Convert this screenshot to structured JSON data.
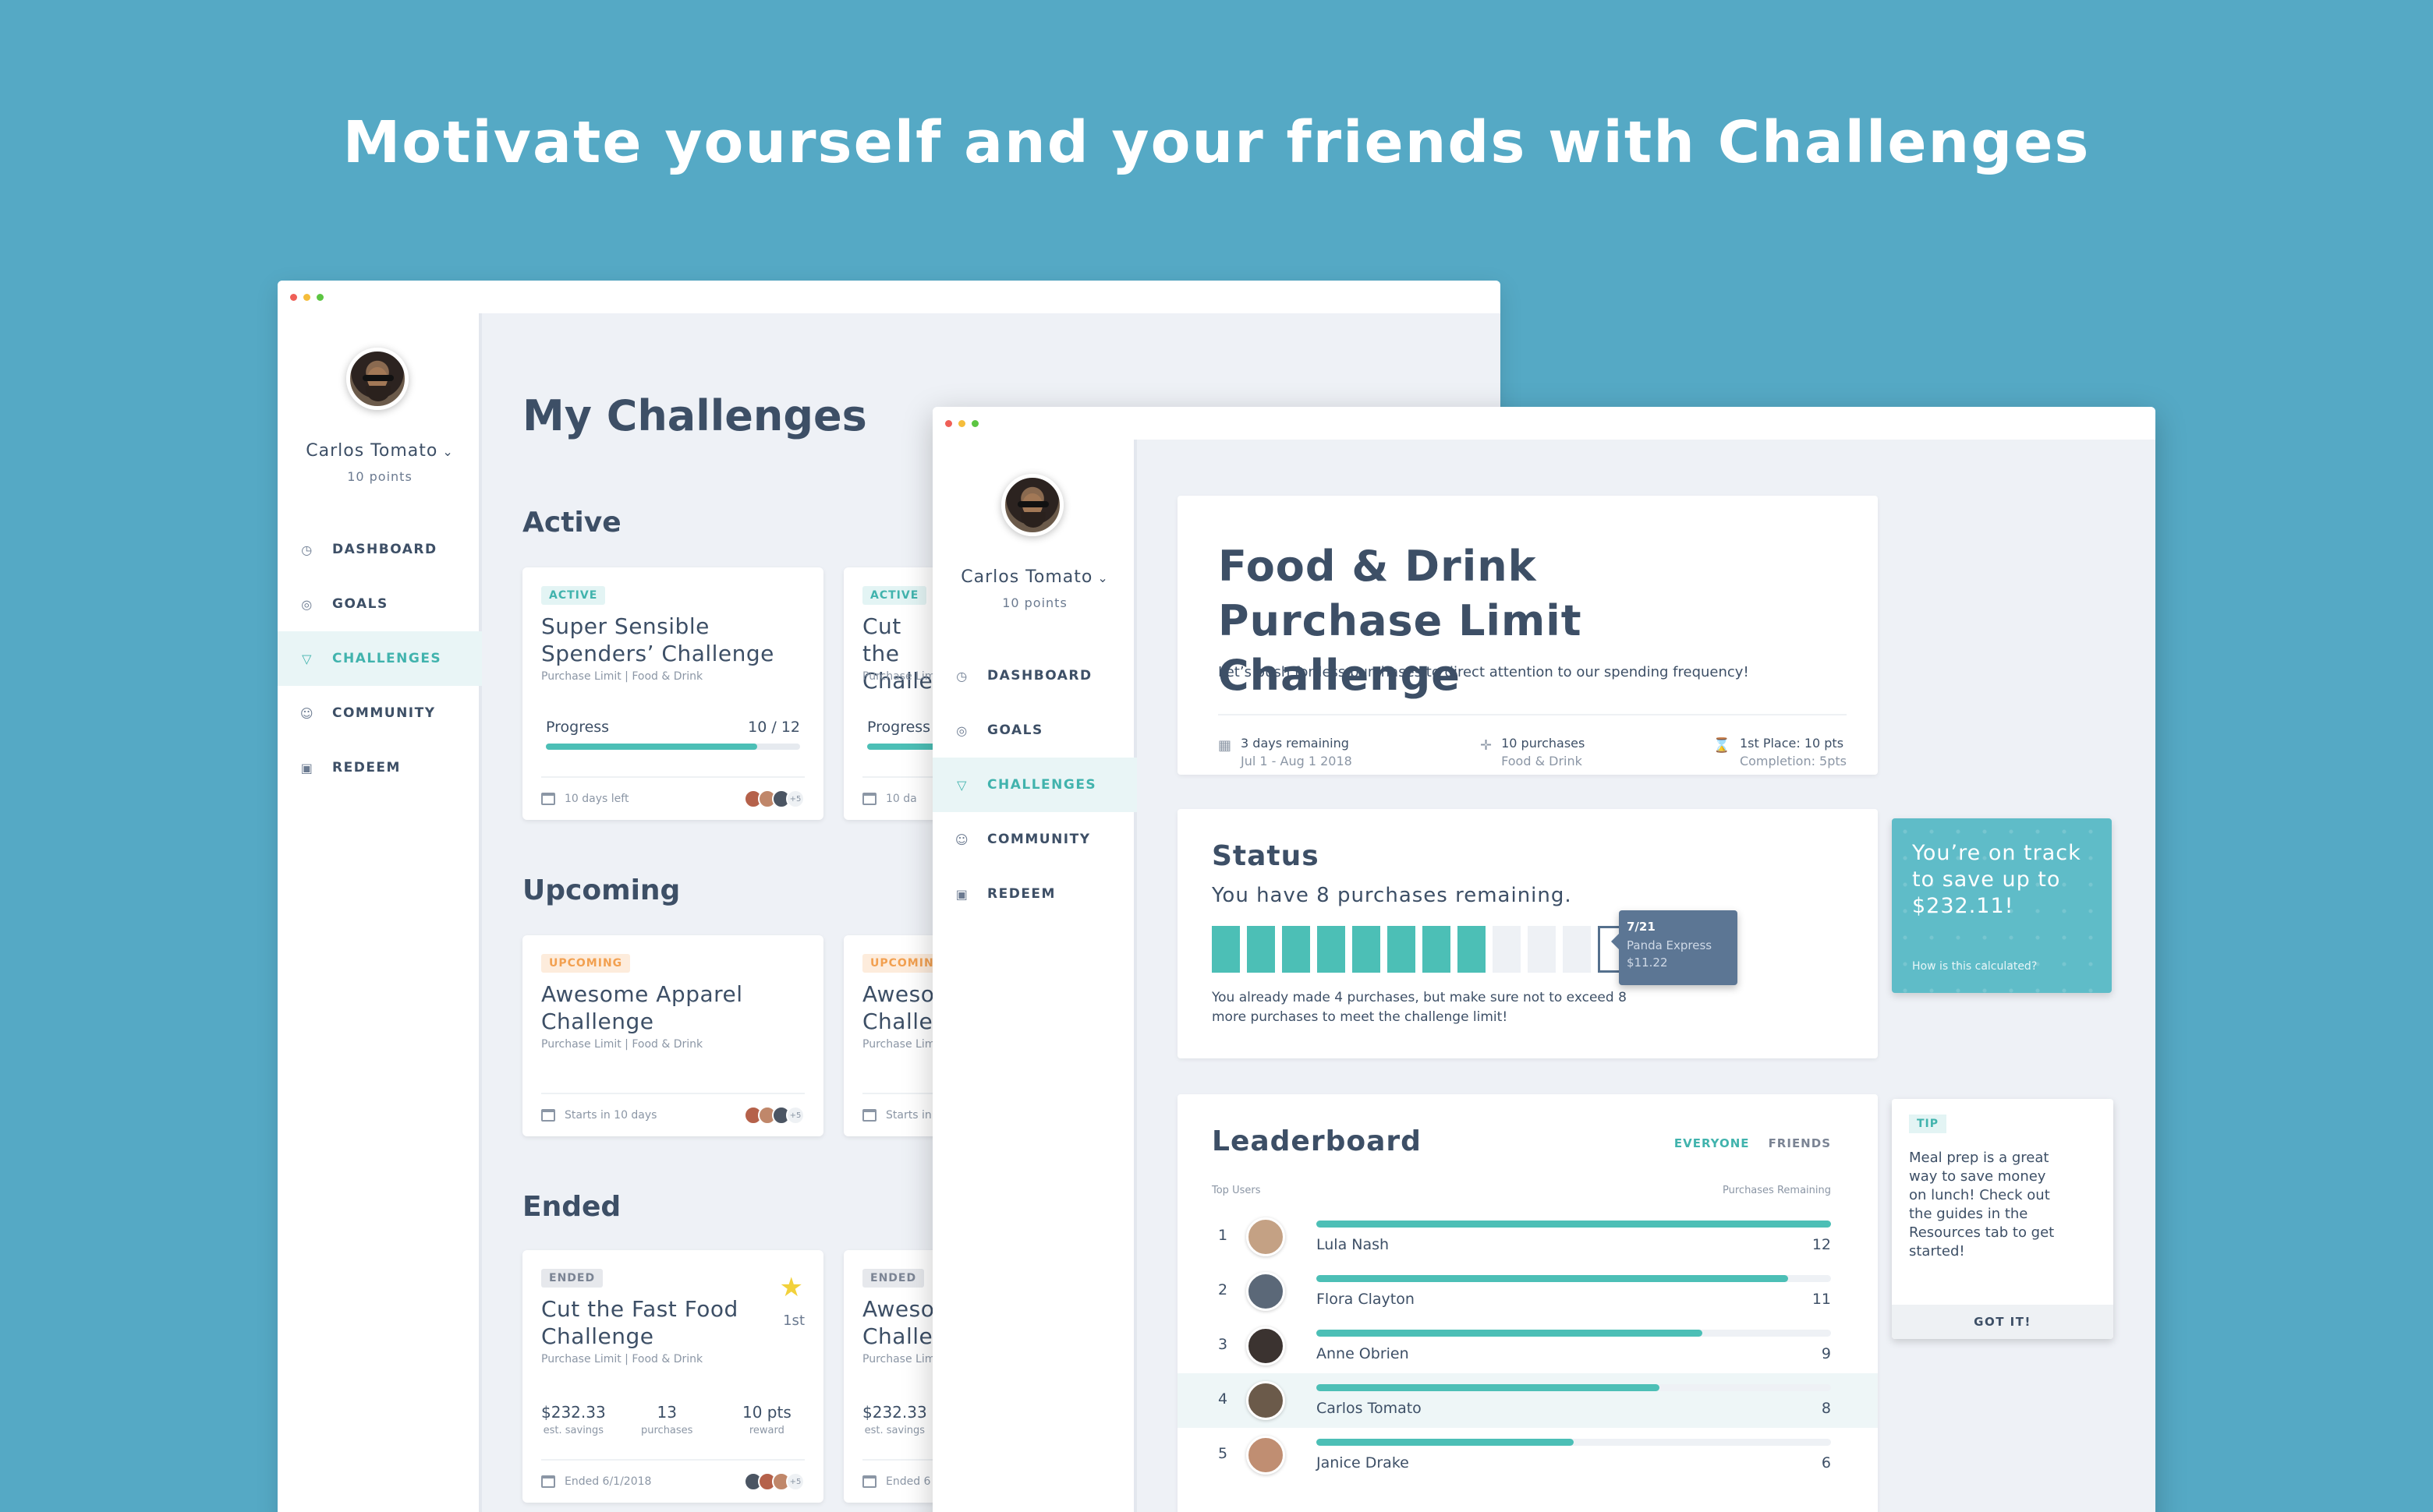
{
  "headline": "Motivate yourself and your friends with Challenges",
  "user": {
    "name": "Carlos Tomato",
    "points": "10 points"
  },
  "nav": [
    {
      "label": "DASHBOARD",
      "icon": "gauge-icon"
    },
    {
      "label": "GOALS",
      "icon": "target-icon"
    },
    {
      "label": "CHALLENGES",
      "icon": "trophy-icon"
    },
    {
      "label": "COMMUNITY",
      "icon": "people-icon"
    },
    {
      "label": "REDEEM",
      "icon": "gift-icon"
    }
  ],
  "active_nav": "CHALLENGES",
  "my_challenges": {
    "title": "My Challenges",
    "sections": {
      "active": "Active",
      "upcoming": "Upcoming",
      "ended": "Ended"
    },
    "active": [
      {
        "badge": "ACTIVE",
        "title": "Super Sensible Spenders’ Challenge",
        "sub": "Purchase Limit  |  Food & Drink",
        "progress_label": "Progress",
        "progress_value": "10 / 12",
        "progress": 0.83,
        "footer": "10 days left",
        "more": "+5"
      },
      {
        "badge": "ACTIVE",
        "title": "Cut the Challe",
        "sub": "Purchase Lim",
        "progress_label": "Progress",
        "progress": 0.5,
        "footer": "10 da"
      }
    ],
    "upcoming": [
      {
        "badge": "UPCOMING",
        "title": "Awesome Apparel Challenge",
        "sub": "Purchase Limit  |  Food & Drink",
        "footer": "Starts in 10 days",
        "more": "+5"
      },
      {
        "badge": "UPCOMIN",
        "title": "Aweso Challe",
        "sub": "Purchase Lim",
        "footer": "Starts in"
      }
    ],
    "ended": [
      {
        "badge": "ENDED",
        "title": "Cut the Fast Food Challenge",
        "sub": "Purchase Limit  |  Food & Drink",
        "place": "1st",
        "stats": [
          {
            "v": "$232.33",
            "l": "est. savings"
          },
          {
            "v": "13",
            "l": "purchases"
          },
          {
            "v": "10 pts",
            "l": "reward"
          }
        ],
        "footer": "Ended 6/1/2018",
        "more": "+5"
      },
      {
        "badge": "ENDED",
        "title": "Aweso Challe",
        "sub": "Purchase Lim",
        "stat_v": "$232.33",
        "stat_l": "est. savings",
        "footer": "Ended 6"
      }
    ]
  },
  "detail": {
    "title": "Food & Drink Purchase Limit Challenge",
    "desc": "Let’s push for less purchases to direct attention to our spending frequency!",
    "meta": [
      {
        "a": "3 days remaining",
        "b": "Jul 1 - Aug 1 2018",
        "icon": "calendar-icon"
      },
      {
        "a": "10 purchases",
        "b": "Food & Drink",
        "icon": "crosshair-icon"
      },
      {
        "a": "1st Place: 10 pts",
        "b": "Completion: 5pts",
        "icon": "hourglass-icon"
      }
    ],
    "status": {
      "title": "Status",
      "text": "You have 8 purchases remaining.",
      "filled_blocks": 8,
      "empty_blocks": 3,
      "selected_block": 12,
      "tooltip": {
        "date": "7/21",
        "merchant": "Panda Express",
        "amount": "$11.22"
      },
      "note": "You already made 4 purchases, but make sure not to exceed 8 more purchases to meet the challenge limit!"
    },
    "track": {
      "text": "You’re on track to save up to $232.11!",
      "link": "How is this calculated?"
    },
    "leaderboard": {
      "title": "Leaderboard",
      "tabs": [
        "EVERYONE",
        "FRIENDS"
      ],
      "col_left": "Top Users",
      "col_right": "Purchases Remaining",
      "rows": [
        {
          "rank": "1",
          "name": "Lula Nash",
          "count": "12",
          "value": 12
        },
        {
          "rank": "2",
          "name": "Flora Clayton",
          "count": "11",
          "value": 11
        },
        {
          "rank": "3",
          "name": "Anne Obrien",
          "count": "9",
          "value": 9
        },
        {
          "rank": "4",
          "name": "Carlos Tomato",
          "count": "8",
          "value": 8
        },
        {
          "rank": "5",
          "name": "Janice Drake",
          "count": "6",
          "value": 6
        }
      ]
    },
    "tip": {
      "badge": "TIP",
      "text": "Meal prep is a great way to save money on lunch! Check out the guides in the Resources tab to get started!",
      "button": "GOT IT!"
    }
  },
  "colors": {
    "background": "#55a9c5",
    "accent": "#4cbfb6",
    "text": "#3d4f66",
    "upcoming": "#f2a050"
  }
}
